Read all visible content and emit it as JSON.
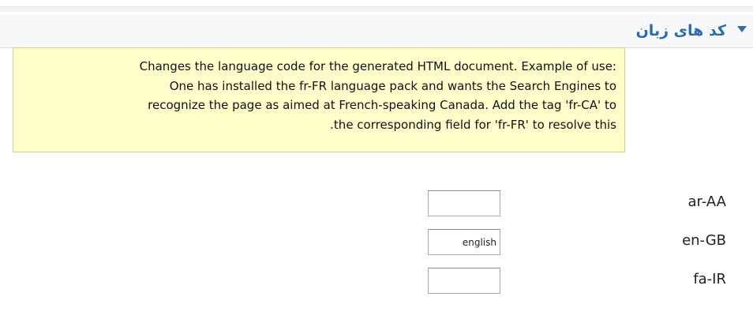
{
  "section": {
    "title": "کد های زبان",
    "toggle_icon": "triangle-down-icon",
    "accent_color": "#2b6cb0"
  },
  "info": {
    "lines": [
      "Changes the language code for the generated HTML document. Example of use:",
      "One has installed the fr-FR language pack and wants the Search Engines to",
      "recognize the page as aimed at French-speaking Canada. Add the tag 'fr-CA' to",
      ".the corresponding field for 'fr-FR' to resolve this"
    ]
  },
  "languages": [
    {
      "code": "ar-AA",
      "value": ""
    },
    {
      "code": "en-GB",
      "value": "english"
    },
    {
      "code": "fa-IR",
      "value": ""
    }
  ]
}
